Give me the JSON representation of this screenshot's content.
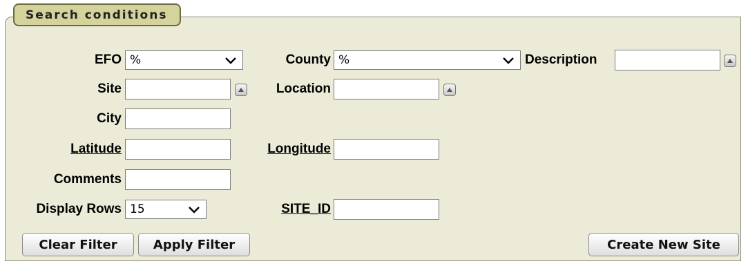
{
  "panel": {
    "title": "Search conditions"
  },
  "fields": {
    "efo": {
      "label": "EFO",
      "value": "%"
    },
    "county": {
      "label": "County",
      "value": "%"
    },
    "description": {
      "label": "Description",
      "value": ""
    },
    "site": {
      "label": "Site",
      "value": ""
    },
    "location": {
      "label": "Location",
      "value": ""
    },
    "city": {
      "label": "City",
      "value": ""
    },
    "latitude": {
      "label": "Latitude",
      "value": ""
    },
    "longitude": {
      "label": "Longitude",
      "value": ""
    },
    "comments": {
      "label": "Comments",
      "value": ""
    },
    "display_rows": {
      "label": "Display Rows",
      "value": "15"
    },
    "site_id": {
      "label": "SITE_ID",
      "value": ""
    }
  },
  "buttons": {
    "clear_filter": "Clear Filter",
    "apply_filter": "Apply Filter",
    "create_new_site": "Create New Site"
  },
  "icons": {
    "lookup": "caret-up-icon",
    "dropdown": "chevron-down-icon"
  }
}
